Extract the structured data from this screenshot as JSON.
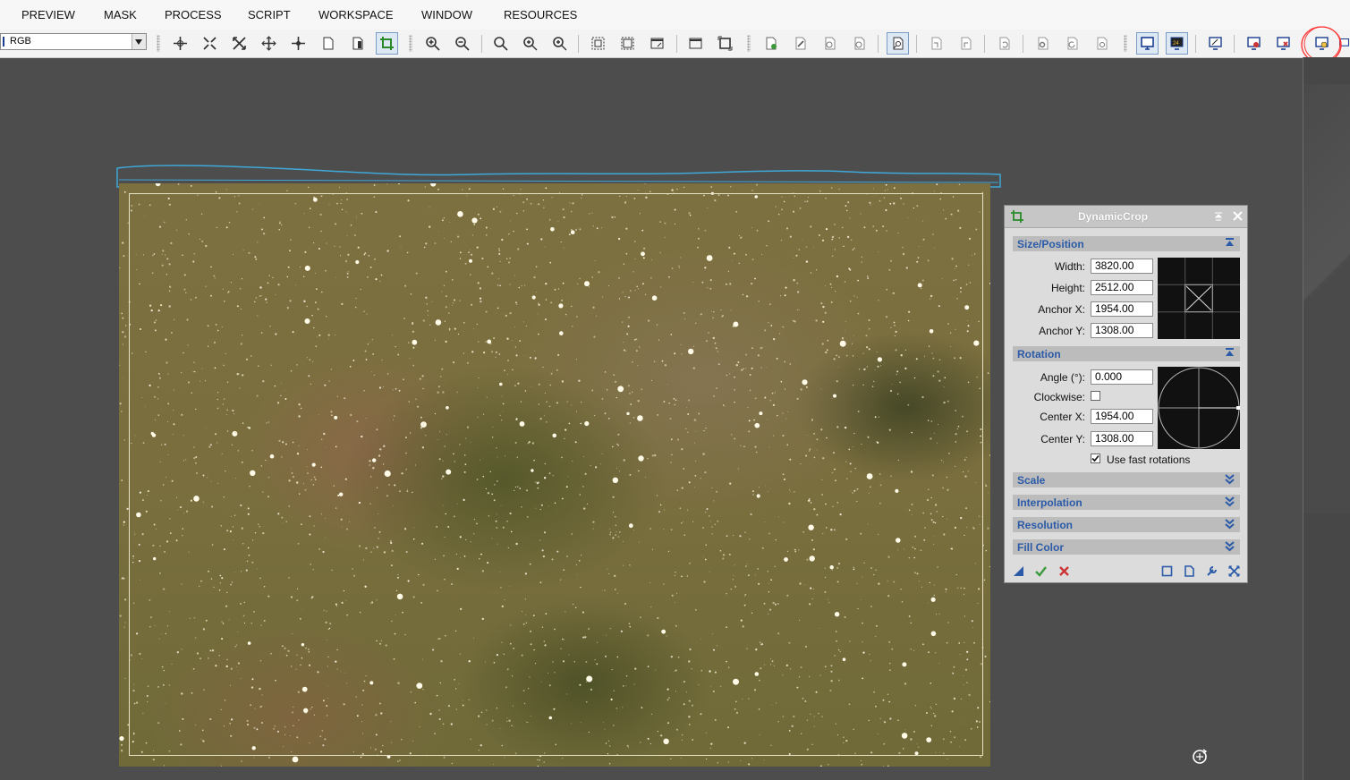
{
  "menu": [
    "PREVIEW",
    "MASK",
    "PROCESS",
    "SCRIPT",
    "WORKSPACE",
    "WINDOW",
    "RESOURCES"
  ],
  "toolbar": {
    "channel_select": "RGB"
  },
  "panel": {
    "title": "DynamicCrop",
    "size_position": {
      "header": "Size/Position",
      "width_label": "Width:",
      "width": "3820.00",
      "height_label": "Height:",
      "height": "2512.00",
      "anchor_x_label": "Anchor X:",
      "anchor_x": "1954.00",
      "anchor_y_label": "Anchor Y:",
      "anchor_y": "1308.00"
    },
    "rotation": {
      "header": "Rotation",
      "angle_label": "Angle (°):",
      "angle": "0.000",
      "clockwise_label": "Clockwise:",
      "clockwise": false,
      "center_x_label": "Center X:",
      "center_x": "1954.00",
      "center_y_label": "Center Y:",
      "center_y": "1308.00",
      "fast_label": "Use fast rotations",
      "fast": true
    },
    "sections": [
      "Scale",
      "Interpolation",
      "Resolution",
      "Fill Color"
    ]
  },
  "colors": {
    "accent": "#2a5aa8",
    "ok": "#3a9a3a",
    "cancel": "#cc3333",
    "annotation": "#ff3333",
    "outline": "#3fa8d8"
  }
}
